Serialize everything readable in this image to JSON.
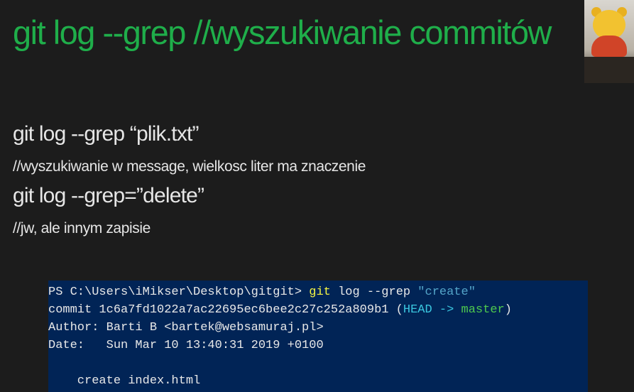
{
  "slide": {
    "title": "git log --grep //wyszukiwanie commitów",
    "lines": [
      "git log --grep “plik.txt”",
      "//wyszukiwanie w message, wielkosc liter ma znaczenie",
      "git log --grep=”delete”",
      "//jw, ale innym zapisie"
    ]
  },
  "webcam": {
    "icon": "webcam-overlay-teddy-bear"
  },
  "terminal": {
    "prompt": "PS C:\\Users\\iMikser\\Desktop\\gitgit> ",
    "command_git": "git",
    "command_args": " log --grep ",
    "command_string": "\"create\"",
    "commit_prefix": "commit 1c6a7fd1022a7ac22695ec6bee2c27c252a809b1 (",
    "head_label": "HEAD ->",
    "branch_label": " master",
    "commit_suffix": ")",
    "author_line": "Author: Barti B <bartek@websamuraj.pl>",
    "date_line": "Date:   Sun Mar 10 13:40:31 2019 +0100",
    "blank_line": "",
    "message_line": "    create index.html",
    "colors": {
      "background": "#012456",
      "command": "#f5f543",
      "string": "#54a5c9",
      "head": "#3ac6df",
      "branch": "#4ec94e"
    }
  }
}
